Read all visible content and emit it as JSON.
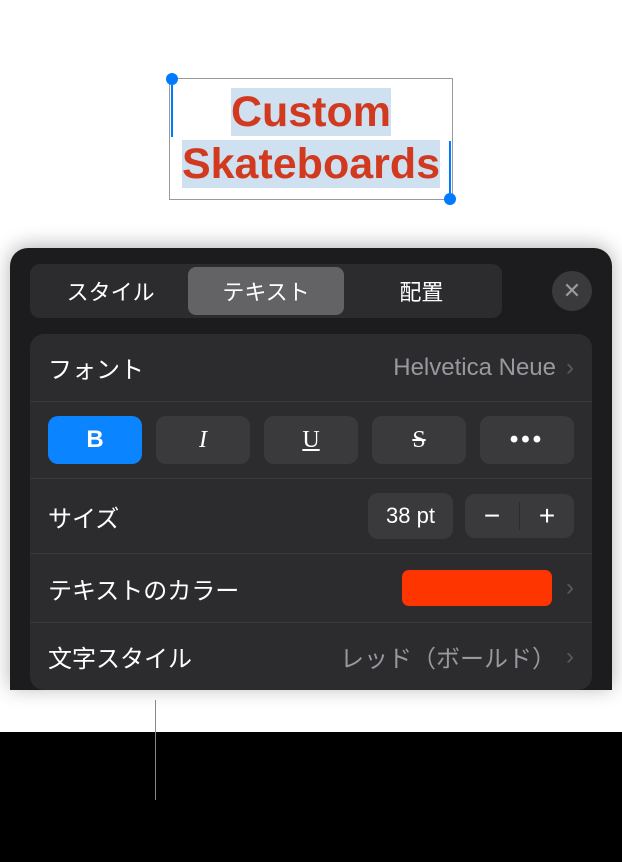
{
  "canvas": {
    "text_line1": "Custom",
    "text_line2": "Skateboards"
  },
  "tabs": {
    "style": "スタイル",
    "text": "テキスト",
    "arrange": "配置"
  },
  "font": {
    "label": "フォント",
    "value": "Helvetica Neue"
  },
  "styleButtons": {
    "bold": "B",
    "italic": "I",
    "underline": "U",
    "strike": "S",
    "more": "•••"
  },
  "size": {
    "label": "サイズ",
    "value": "38 pt",
    "minus": "−",
    "plus": "+"
  },
  "textColor": {
    "label": "テキストのカラー",
    "hex": "#FF3500"
  },
  "charStyle": {
    "label": "文字スタイル",
    "value": "レッド（ボールド）"
  },
  "close": "✕"
}
